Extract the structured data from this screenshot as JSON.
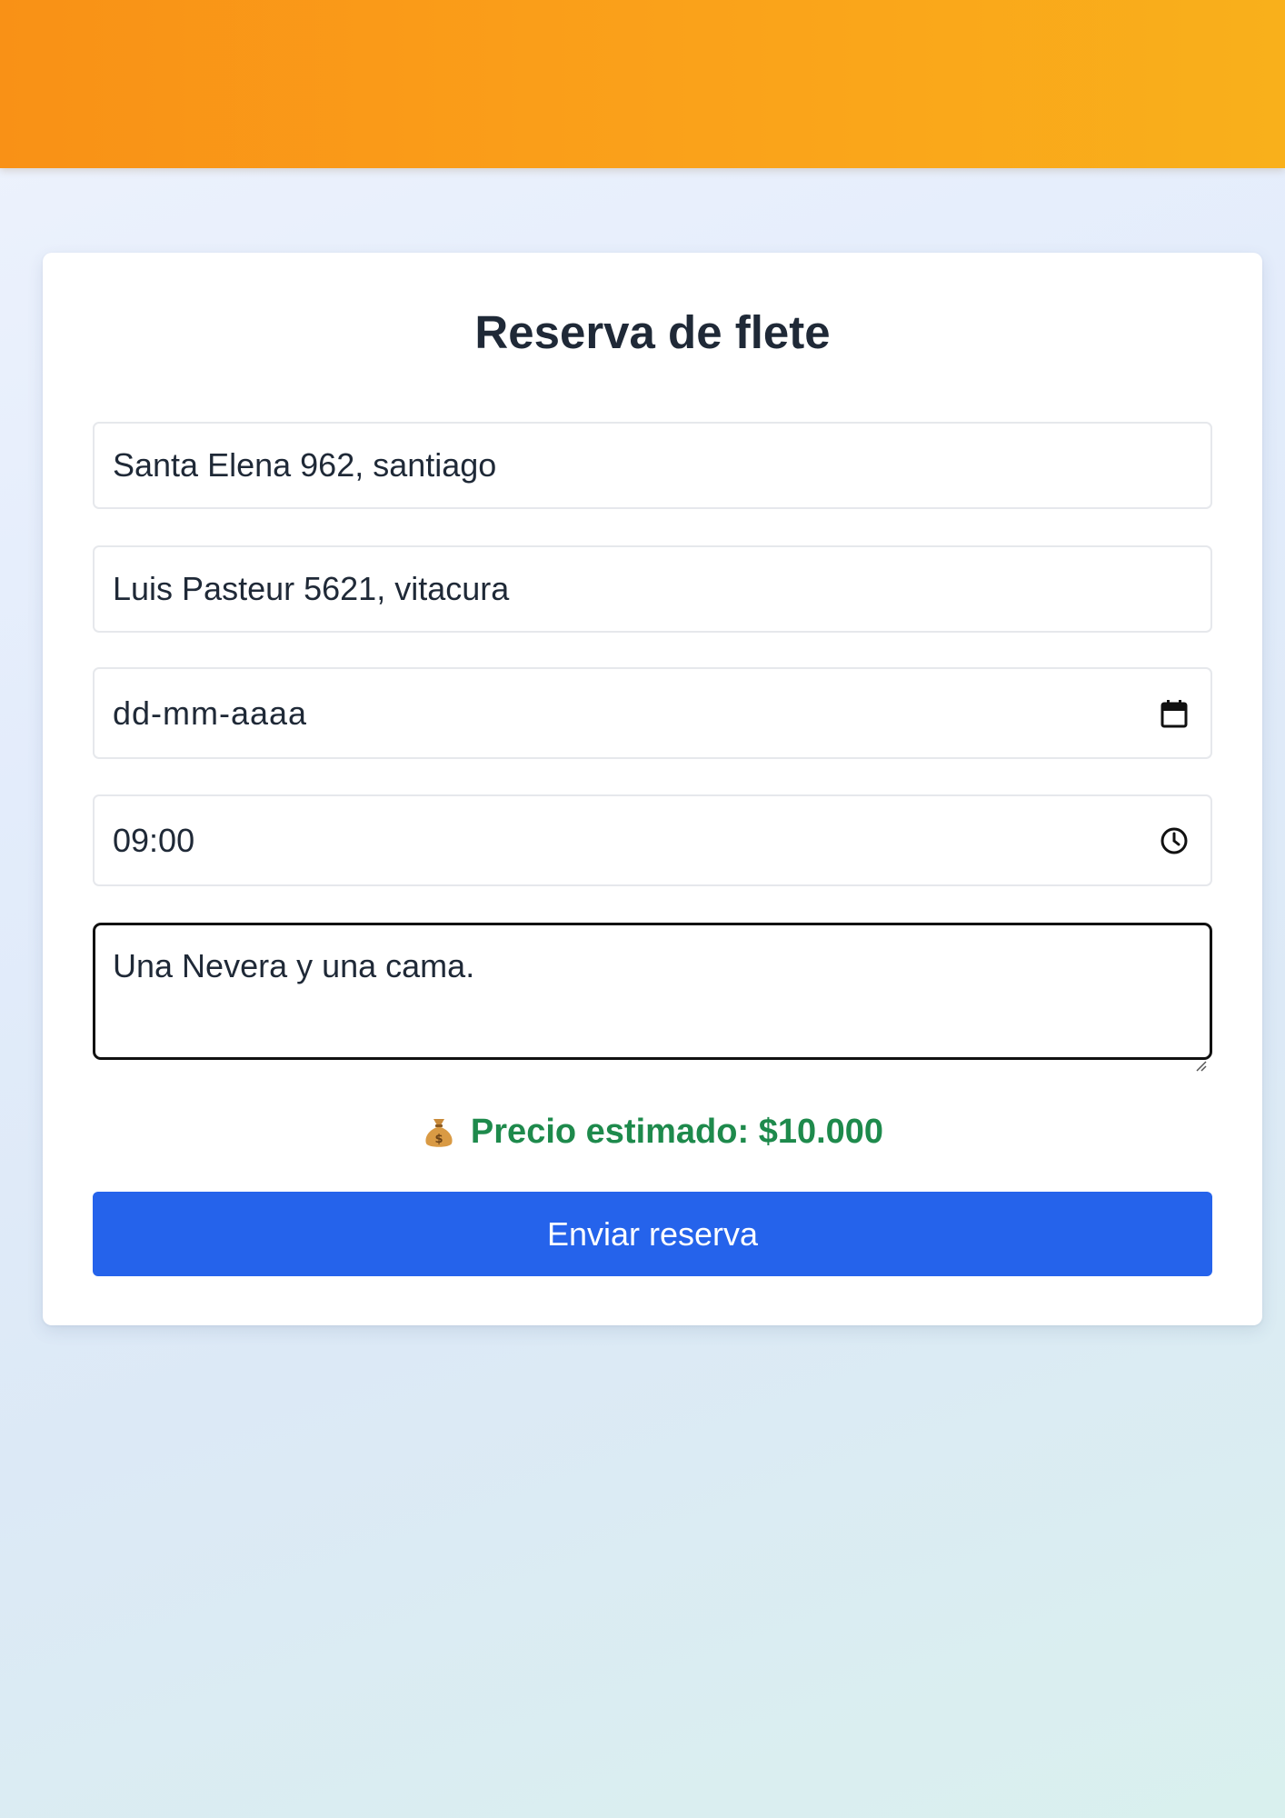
{
  "header": {
    "accent_color": "#f99116"
  },
  "form": {
    "title": "Reserva de flete",
    "origin": {
      "value": "Santa Elena 962, santiago"
    },
    "destination": {
      "value": "Luis Pasteur 5621, vitacura"
    },
    "date": {
      "placeholder": "dd-mm-aaaa",
      "icon": "calendar-icon"
    },
    "time": {
      "value": "09:00",
      "icon": "clock-icon"
    },
    "description": {
      "value": "Una Nevera y una cama."
    },
    "price": {
      "icon": "money-bag-icon",
      "text": "Precio estimado: $10.000",
      "color": "#1e8a4c"
    },
    "submit_label": "Enviar reserva",
    "submit_color": "#2563eb"
  }
}
